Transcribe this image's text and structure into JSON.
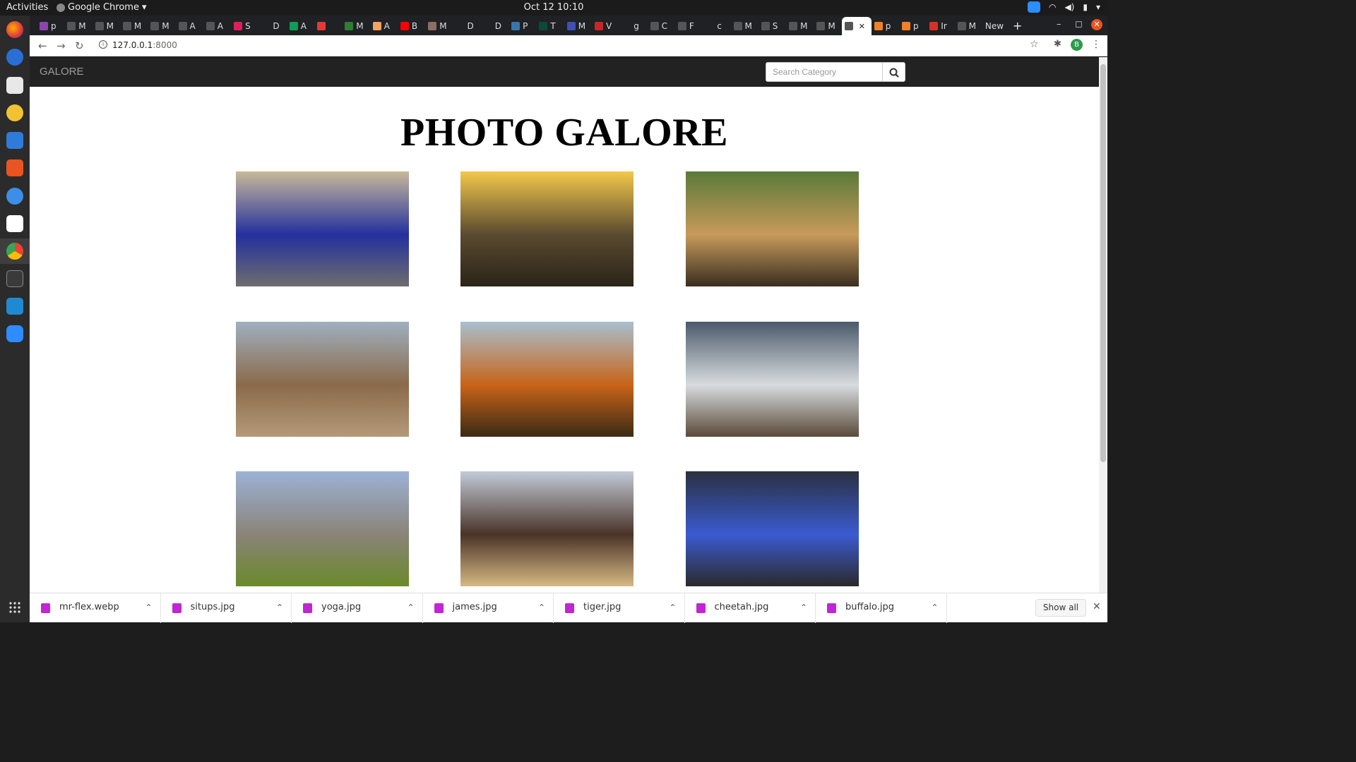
{
  "os_topbar": {
    "activities": "Activities",
    "app_name": "Google Chrome",
    "clock": "Oct 12  10:10"
  },
  "browser": {
    "tabs": [
      {
        "label": "p",
        "favicon_color": "#8e44ad",
        "active": false
      },
      {
        "label": "M",
        "favicon_color": "#555555",
        "active": false
      },
      {
        "label": "M",
        "favicon_color": "#555555",
        "active": false
      },
      {
        "label": "M",
        "favicon_color": "#555555",
        "active": false
      },
      {
        "label": "M",
        "favicon_color": "#555555",
        "active": false
      },
      {
        "label": "A",
        "favicon_color": "#555555",
        "active": false
      },
      {
        "label": "A",
        "favicon_color": "#555555",
        "active": false
      },
      {
        "label": "S",
        "favicon_color": "#e01e5a",
        "active": false
      },
      {
        "label": "D",
        "favicon_color": "#202124",
        "active": false
      },
      {
        "label": "A",
        "favicon_color": "#0f9d58",
        "active": false
      },
      {
        "label": "",
        "favicon_color": "#e53935",
        "active": false
      },
      {
        "label": "M",
        "favicon_color": "#2e7d32",
        "active": false
      },
      {
        "label": "A",
        "favicon_color": "#f4a261",
        "active": false
      },
      {
        "label": "B",
        "favicon_color": "#ff0000",
        "active": false
      },
      {
        "label": "M",
        "favicon_color": "#8d6e63",
        "active": false
      },
      {
        "label": "D",
        "favicon_color": "#202124",
        "active": false
      },
      {
        "label": "D",
        "favicon_color": "#202124",
        "active": false
      },
      {
        "label": "P",
        "favicon_color": "#3776ab",
        "active": false
      },
      {
        "label": "T",
        "favicon_color": "#0c4b33",
        "active": false
      },
      {
        "label": "M",
        "favicon_color": "#3f51b5",
        "active": false
      },
      {
        "label": "V",
        "favicon_color": "#c62828",
        "active": false
      },
      {
        "label": "g",
        "favicon_color": "#202124",
        "active": false
      },
      {
        "label": "C",
        "favicon_color": "#555555",
        "active": false
      },
      {
        "label": "F",
        "favicon_color": "#555555",
        "active": false
      },
      {
        "label": "c",
        "favicon_color": "#202124",
        "active": false
      },
      {
        "label": "M",
        "favicon_color": "#555555",
        "active": false
      },
      {
        "label": "S",
        "favicon_color": "#555555",
        "active": false
      },
      {
        "label": "M",
        "favicon_color": "#555555",
        "active": false
      },
      {
        "label": "M",
        "favicon_color": "#555555",
        "active": false
      },
      {
        "label": "",
        "favicon_color": "#555555",
        "active": true
      },
      {
        "label": "p",
        "favicon_color": "#f48024",
        "active": false
      },
      {
        "label": "p",
        "favicon_color": "#f48024",
        "active": false
      },
      {
        "label": "Ir",
        "favicon_color": "#d93025",
        "active": false
      },
      {
        "label": "M",
        "favicon_color": "#555555",
        "active": false
      },
      {
        "label": "New",
        "favicon_color": "",
        "active": false
      }
    ],
    "url_host": "127.0.0.1",
    "url_port": ":8000"
  },
  "site": {
    "brand": "GALORE",
    "search_placeholder": "Search Category",
    "title": "PHOTO GALORE",
    "photos": [
      {
        "name": "photo-blue-suv",
        "subject": "Blue SUV on road",
        "colors": [
          "#c8b99a",
          "#24309e",
          "#6d6d6d"
        ]
      },
      {
        "name": "photo-african-animals",
        "subject": "Elephant, buffalo, rhino, lion and cheetah at sunset",
        "colors": [
          "#f3c84a",
          "#5a4a30",
          "#2a2418"
        ]
      },
      {
        "name": "photo-leopard-tree",
        "subject": "Leopard resting on a tree",
        "colors": [
          "#5a7a3a",
          "#c79a5a",
          "#3a2e20"
        ]
      },
      {
        "name": "photo-elephant-herd",
        "subject": "Elephant herd walking",
        "colors": [
          "#9fb0c0",
          "#8a6a4a",
          "#b59a78"
        ]
      },
      {
        "name": "photo-lion",
        "subject": "Male lion portrait",
        "colors": [
          "#a8c0cf",
          "#c86418",
          "#3a2a14"
        ]
      },
      {
        "name": "photo-white-suv",
        "subject": "White SUV",
        "colors": [
          "#4a5a6a",
          "#d8dcdf",
          "#5a4a3a"
        ]
      },
      {
        "name": "photo-rhino",
        "subject": "Rhino grazing",
        "colors": [
          "#9cb2d6",
          "#8a8378",
          "#6b8a2a"
        ]
      },
      {
        "name": "photo-buffalo",
        "subject": "Cape buffalo standing",
        "colors": [
          "#c3cbd8",
          "#4a3328",
          "#d6b984"
        ]
      },
      {
        "name": "photo-situps",
        "subject": "Man doing sit-ups in gym",
        "colors": [
          "#2a3040",
          "#3b5bd0",
          "#2a2a2a"
        ]
      }
    ]
  },
  "downloads": {
    "items": [
      {
        "filename": "mr-flex.webp"
      },
      {
        "filename": "situps.jpg"
      },
      {
        "filename": "yoga.jpg"
      },
      {
        "filename": "james.jpg"
      },
      {
        "filename": "tiger.jpg"
      },
      {
        "filename": "cheetah.jpg"
      },
      {
        "filename": "buffalo.jpg"
      }
    ],
    "show_all_label": "Show all"
  },
  "colors": {
    "navbar_bg": "#222222",
    "brand_text": "#9d9d9d",
    "download_icon": "#c026d3",
    "profile_avatar": "#2e9b4b"
  },
  "profile_initial": "B"
}
